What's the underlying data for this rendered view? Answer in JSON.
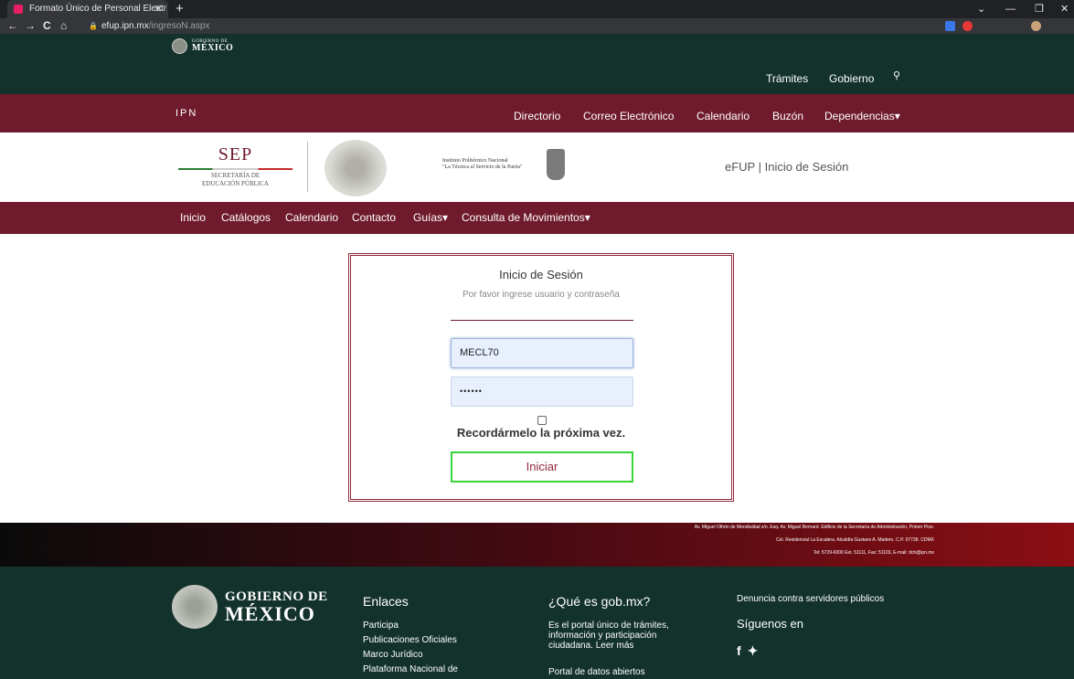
{
  "browser": {
    "tab_title": "Formato Único de Personal Electr",
    "tab_close": "✕",
    "new_tab": "+",
    "url_host": "efup.ipn.mx",
    "url_path": "/ingresoN.aspx",
    "nav_back": "←",
    "nav_forward": "→",
    "nav_reload": "C",
    "nav_home": "⌂",
    "win_minimize": "—",
    "win_restore": "❐",
    "win_close": "✕",
    "win_chevron": "⌄"
  },
  "gob_header": {
    "logo_line1": "GOBIERNO DE",
    "logo_line2": "MÉXICO",
    "tramites": "Trámites",
    "gobierno": "Gobierno",
    "search_glyph": "🔍"
  },
  "ipn_bar": {
    "label": "IPN",
    "links": [
      "Directorio",
      "Correo Electrónico",
      "Calendario",
      "Buzón",
      "Dependencias▾"
    ]
  },
  "banner": {
    "sep_big": "SEP",
    "sep_line1": "SECRETARÍA DE",
    "sep_line2": "EDUCACIÓN PÚBLICA",
    "ipn_line1": "Instituto Politécnico Nacional",
    "ipn_line2": "\"La Técnica al Servicio de la Patria\"",
    "page_title": "eFUP | Inicio de Sesión"
  },
  "subnav": {
    "links": [
      "Inicio",
      "Catálogos",
      "Calendario",
      "Contacto",
      "Guías▾",
      "Consulta de Movimientos▾"
    ]
  },
  "login": {
    "title": "Inicio de Sesión",
    "subtitle": "Por favor ingrese usuario y contraseña",
    "username_value": "MECL70",
    "password_value": "••••••",
    "remember_label": "Recordármelo la próxima vez.",
    "remember_checked": false,
    "submit_label": "Iniciar"
  },
  "address_footer": {
    "line1": "Av. Miguel Othón de Mendizábal s/n. Esq. Av. Miguel Bernard. Edificio de la Secretaría de Administración, Primer Piso.",
    "line2": "Col. Residencial La Escalera. Alcaldía Gustavo A. Madero. C.P. 07738. CDMX",
    "line3": "Tel: 5729-6000 Ext. 51111, Fax: 51103, E-mail: dch@ipn.mx"
  },
  "footer": {
    "logo_line1": "GOBIERNO DE",
    "logo_line2": "MÉXICO",
    "enlaces_title": "Enlaces",
    "enlaces": [
      "Participa",
      "Publicaciones Oficiales",
      "Marco Jurídico",
      "Plataforma Nacional de"
    ],
    "que_es_title": "¿Qué es gob.mx?",
    "que_es_line1": "Es el portal único de trámites,",
    "que_es_line2": "información y participación",
    "que_es_line3": "ciudadana. Leer más",
    "datos_abiertos": "Portal de datos abiertos",
    "denuncia": "Denuncia contra servidores públicos",
    "siguenos": "Síguenos en",
    "social_icons": "f 🐦"
  },
  "colors": {
    "gob_green": "#13322b",
    "ipn_guinda": "#6f1a2d",
    "button_border": "#38d438"
  }
}
